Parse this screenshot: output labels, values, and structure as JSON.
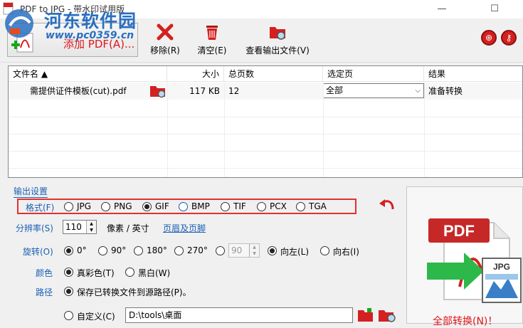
{
  "window": {
    "title": "PDF to JPG - 带水印试用版",
    "minimize": "—",
    "maximize": "☐"
  },
  "watermark": {
    "site_name": "河东软件园",
    "url": "www.pc0359.cn"
  },
  "toolbar": {
    "add_pdf": "添加 PDF(A)...",
    "remove": "移除(R)",
    "clear": "清空(E)",
    "view_output": "查看输出文件(V)"
  },
  "file_list": {
    "columns": [
      "文件名 ▲",
      "大小",
      "总页数",
      "选定页",
      "结果"
    ],
    "rows": [
      {
        "name": "需提供证件模板(cut).pdf",
        "size": "117 KB",
        "pages": "12",
        "selection": "全部",
        "result": "准备转换"
      }
    ]
  },
  "settings": {
    "section_title": "输出设置",
    "format": {
      "label": "格式(F)",
      "options": [
        "JPG",
        "PNG",
        "GIF",
        "BMP",
        "TIF",
        "PCX",
        "TGA"
      ],
      "selected": "GIF"
    },
    "resolution": {
      "label": "分辨率(S)",
      "value": "110",
      "unit": "像素 / 英寸",
      "header_footer_link": "页眉及页脚"
    },
    "rotation": {
      "label": "旋转(O)",
      "options": [
        "0°",
        "90°",
        "180°",
        "270°"
      ],
      "selected": "0°",
      "custom_value": "90",
      "left": "向左(L)",
      "right": "向右(I)",
      "direction_selected": "向左(L)"
    },
    "color": {
      "label": "颜色",
      "options": [
        "真彩色(T)",
        "黑白(W)"
      ],
      "selected": "真彩色(T)"
    },
    "path": {
      "label": "路径",
      "save_to_source": "保存已转换文件到源路径(P)。",
      "custom_label": "自定义(C)",
      "custom_value": "D:\\tools\\桌面",
      "selected": "save_to_source"
    }
  },
  "convert": {
    "label": "全部转换(N)！",
    "pdf_badge": "PDF",
    "jpg_badge": "JPG"
  },
  "colors": {
    "accent_blue": "#1a5fb4",
    "accent_red": "#e0151b"
  }
}
